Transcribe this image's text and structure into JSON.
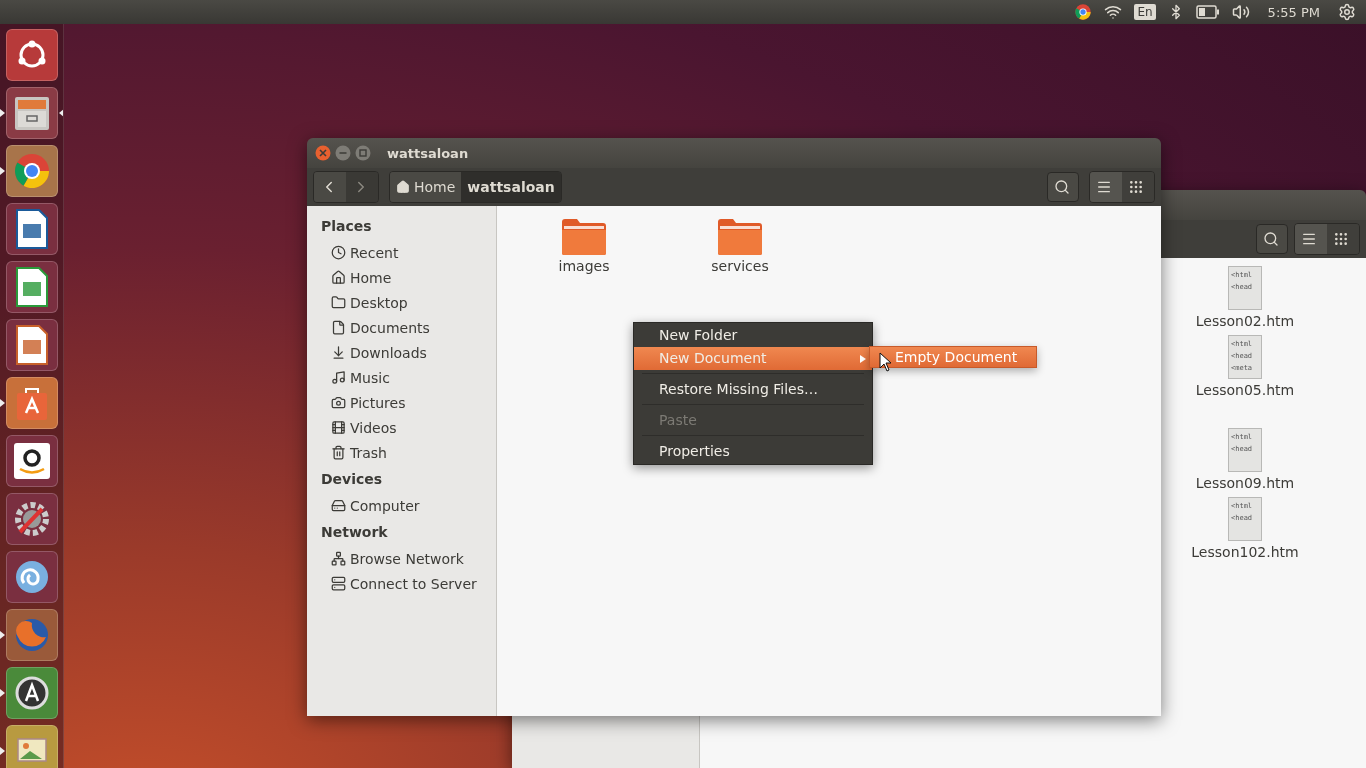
{
  "panel": {
    "keyboard": "En",
    "clock": "5:55 PM"
  },
  "launcher": [
    {
      "kind": "ubuntu",
      "running": false,
      "focused": false
    },
    {
      "kind": "files",
      "running": true,
      "focused": true
    },
    {
      "kind": "chrome",
      "running": true,
      "focused": false
    },
    {
      "kind": "writer",
      "running": false,
      "focused": false
    },
    {
      "kind": "calc",
      "running": false,
      "focused": false
    },
    {
      "kind": "impress",
      "running": false,
      "focused": false
    },
    {
      "kind": "software",
      "running": true,
      "focused": false
    },
    {
      "kind": "amazon",
      "running": false,
      "focused": false
    },
    {
      "kind": "settings",
      "running": false,
      "focused": false
    },
    {
      "kind": "swirl",
      "running": false,
      "focused": false
    },
    {
      "kind": "firefox",
      "running": true,
      "focused": false
    },
    {
      "kind": "updater",
      "running": true,
      "focused": false
    },
    {
      "kind": "viewer",
      "running": true,
      "focused": false
    }
  ],
  "back_window": {
    "view_buttons": [
      {
        "kind": "list",
        "selected": true
      },
      {
        "kind": "grid",
        "selected": false
      }
    ],
    "files": [
      {
        "name": "Lesson02.htm",
        "preview": [
          "<html",
          "<head"
        ]
      },
      {
        "name": "Lesson05.htm",
        "preview": [
          "<html",
          "<head",
          "<meta"
        ]
      },
      {
        "name": "Lesson09.htm",
        "preview": [
          "<html",
          "<head"
        ]
      },
      {
        "name": "Lesson102.htm",
        "preview": [
          "<html",
          "<head"
        ]
      }
    ]
  },
  "window": {
    "title": "wattsaloan",
    "nav": [
      {
        "kind": "back",
        "disabled": false
      },
      {
        "kind": "forward",
        "disabled": true
      }
    ],
    "path": [
      {
        "label": "Home",
        "kind": "home",
        "selected": false
      },
      {
        "label": "wattsaloan",
        "kind": "folder",
        "selected": true
      }
    ],
    "view_buttons": [
      {
        "kind": "list",
        "selected": true
      },
      {
        "kind": "grid",
        "selected": false
      }
    ],
    "sidebar": [
      {
        "title": "Places",
        "items": [
          {
            "label": "Recent",
            "kind": "recent"
          },
          {
            "label": "Home",
            "kind": "home"
          },
          {
            "label": "Desktop",
            "kind": "desktop"
          },
          {
            "label": "Documents",
            "kind": "documents"
          },
          {
            "label": "Downloads",
            "kind": "downloads"
          },
          {
            "label": "Music",
            "kind": "music"
          },
          {
            "label": "Pictures",
            "kind": "pictures"
          },
          {
            "label": "Videos",
            "kind": "videos"
          },
          {
            "label": "Trash",
            "kind": "trash"
          }
        ]
      },
      {
        "title": "Devices",
        "items": [
          {
            "label": "Computer",
            "kind": "computer"
          }
        ]
      },
      {
        "title": "Network",
        "items": [
          {
            "label": "Browse Network",
            "kind": "network"
          },
          {
            "label": "Connect to Server",
            "kind": "server"
          }
        ]
      }
    ],
    "folders": [
      {
        "name": "images"
      },
      {
        "name": "services"
      }
    ],
    "context_menu": {
      "items": [
        {
          "kind": "item",
          "label": "New Folder",
          "selected": false,
          "disabled": false,
          "submenu": false
        },
        {
          "kind": "item",
          "label": "New Document",
          "selected": true,
          "disabled": false,
          "submenu": true
        },
        {
          "kind": "separator"
        },
        {
          "kind": "item",
          "label": "Restore Missing Files…",
          "selected": false,
          "disabled": false,
          "submenu": false
        },
        {
          "kind": "separator"
        },
        {
          "kind": "item",
          "label": "Paste",
          "selected": false,
          "disabled": true,
          "submenu": false
        },
        {
          "kind": "separator"
        },
        {
          "kind": "item",
          "label": "Properties",
          "selected": false,
          "disabled": false,
          "submenu": false
        }
      ],
      "submenu": [
        {
          "label": "Empty Document",
          "selected": true
        }
      ]
    }
  }
}
